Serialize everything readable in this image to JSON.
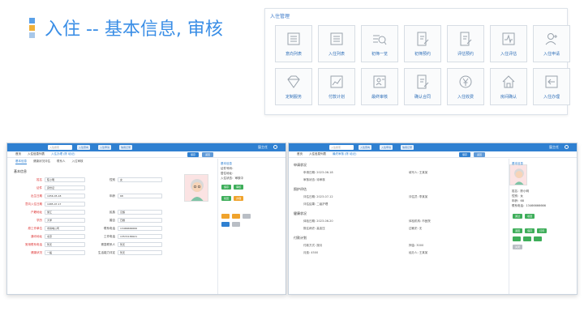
{
  "slide": {
    "title": "入住 -- 基本信息, 审核",
    "deco_colors": [
      "#5aa0e8",
      "#f0b038",
      "#a8c8ea"
    ]
  },
  "menu_panel": {
    "title": "入住管理",
    "tiles": [
      {
        "label": "意向列表",
        "icon": "list-icon"
      },
      {
        "label": "入住列表",
        "icon": "list-icon"
      },
      {
        "label": "初筛一览",
        "icon": "search-doc-icon"
      },
      {
        "label": "初筛预约",
        "icon": "edit-doc-icon"
      },
      {
        "label": "评估预约",
        "icon": "edit-doc-icon"
      },
      {
        "label": "入住评估",
        "icon": "pulse-icon"
      },
      {
        "label": "入住申请",
        "icon": "user-add-icon"
      },
      {
        "label": "定制服务",
        "icon": "diamond-icon"
      },
      {
        "label": "付款计划",
        "icon": "chart-icon"
      },
      {
        "label": "最终审核",
        "icon": "user-card-icon"
      },
      {
        "label": "确认合同",
        "icon": "edit-doc-icon"
      },
      {
        "label": "入住收费",
        "icon": "yen-icon"
      },
      {
        "label": "房间确认",
        "icon": "home-icon"
      },
      {
        "label": "入住办理",
        "icon": "enter-icon"
      }
    ]
  },
  "left_shot": {
    "user": "窗主任",
    "badge": "123",
    "search": "入住搜索",
    "btns": [
      "入住意向",
      "入住申请",
      "信用记录"
    ],
    "tabs": [
      "首页",
      "入住信息列表",
      "入住办理 (陈 培记)"
    ],
    "save": "保存",
    "back": "返回",
    "subtabs": [
      "基本信息",
      "健康状况评估",
      "联系人",
      "入住审核"
    ],
    "section": "基本信息",
    "fields": [
      {
        "label": "姓名",
        "value": "陈小明",
        "label2": "性别",
        "value2": "女"
      },
      {
        "label": "证件",
        "value": "身份证"
      },
      {
        "label": "出生日期",
        "value": "1956-05-18",
        "label2": "年龄",
        "value2": "68"
      },
      {
        "label": "意向入住日期",
        "value": "1985-07-17"
      },
      {
        "label": "户籍地址",
        "value": "浙江",
        "label2": "民族",
        "value2": "汉族"
      },
      {
        "label": "学历",
        "value": "大学",
        "label2": "婚否",
        "value2": "已婚"
      },
      {
        "label": "原工作单位",
        "value": "市供电公司",
        "label2": "联系电话",
        "value2": "13466666666"
      },
      {
        "label": "通讯地址",
        "value": "北京",
        "label2": "工作电话",
        "value2": "13572136621"
      },
      {
        "label": "常用联系电话",
        "value": "暂无",
        "label2": "紧急联系人",
        "value2": "暂无"
      },
      {
        "label": "健康状况",
        "value": "一般",
        "label2": "生活能力评定",
        "value2": "暂无"
      }
    ],
    "sidebar": {
      "title": "基本信息",
      "lines": [
        "证件号码：",
        "居住地址：",
        "入住状态：审核中"
      ],
      "btns": [
        "保存",
        "审核",
        "驳回",
        "办理"
      ]
    }
  },
  "right_shot": {
    "user": "窗主任",
    "search": "入住搜索",
    "tabs": [
      "首页",
      "入住信息列表",
      "最终审核 (陈 培记)"
    ],
    "sections": [
      {
        "title": "申请状况",
        "rows": [
          [
            "申请日期: 2023-06-18",
            "填写人: 王某某"
          ],
          [
            "审核状态: 待审核",
            ""
          ]
        ]
      },
      {
        "title": "照护评估",
        "rows": [
          [
            "评估日期: 2023-07-12",
            "评估员: 李某某"
          ],
          [
            "评估结果: 二级护理",
            ""
          ]
        ]
      },
      {
        "title": "健康状况",
        "rows": [
          [
            "体检日期: 2023-06-20",
            "体检机构: 市医院"
          ],
          [
            "既往病史: 高血压",
            "过敏史: 无"
          ]
        ]
      },
      {
        "title": "付款计划",
        "rows": [
          [
            "付款方式: 按月",
            "押金: 3000"
          ],
          [
            "月费: 4500",
            "经办人: 王某某"
          ]
        ]
      }
    ],
    "sidebar": {
      "title": "基本信息",
      "lines": [
        "姓名：陈小明",
        "性别：女",
        "年龄：68",
        "联系电话：13466666666"
      ],
      "btns": [
        "通过",
        "驳回",
        "退回",
        "保存",
        "打印",
        "关闭"
      ]
    }
  }
}
